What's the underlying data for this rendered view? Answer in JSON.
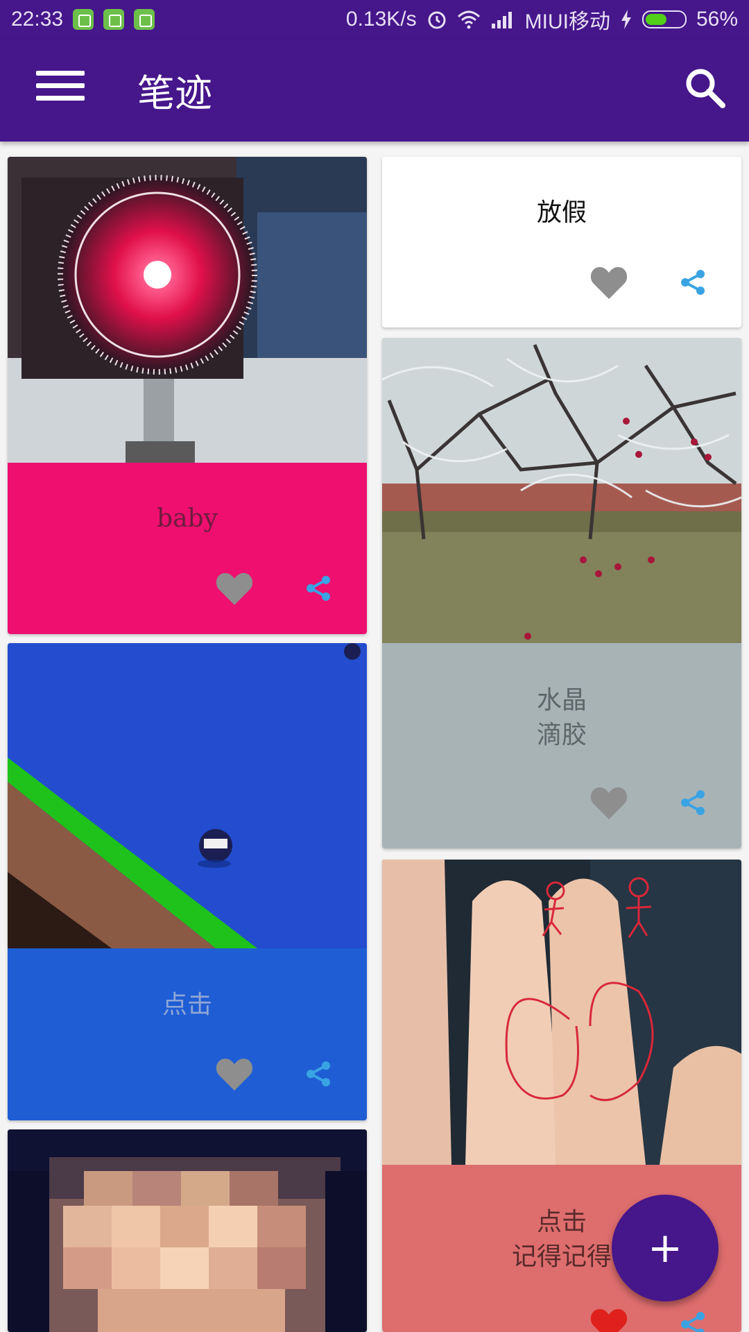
{
  "status_bar": {
    "time": "22:33",
    "speed": "0.13K/s",
    "carrier": "MIUI移动",
    "battery": "56%",
    "battery_level": 0.56
  },
  "app_bar": {
    "title": "笔迹",
    "menu_icon": "hamburger-menu-icon",
    "search_icon": "search-icon"
  },
  "notes": [
    {
      "id": "baby",
      "text": "baby",
      "image": "laser-protractor-photo",
      "color": "#ee0f6f",
      "text_color": "#6d1c3d",
      "liked": false
    },
    {
      "id": "fangjia",
      "text": "放假",
      "image": null,
      "color": "#ffffff",
      "text_color": "#111111",
      "liked": false
    },
    {
      "id": "shuijing",
      "text": "水晶\n滴胶",
      "image": "frosted-tree-photo",
      "color": "#a8b3b6",
      "text_color": "#5d6668",
      "liked": false
    },
    {
      "id": "dianji1",
      "text": "点击",
      "image": "billiard-table-photo",
      "color": "#1f5dd4",
      "text_color": "#8fa6d6",
      "liked": false
    },
    {
      "id": "dianji2",
      "text": "点击\n记得记得",
      "image": "finger-drawing-photo",
      "color": "#de6d6e",
      "text_color": "#5a2a2a",
      "liked": true
    },
    {
      "id": "portrait",
      "text": "",
      "image": "pixelated-portrait-photo",
      "color": "#222222",
      "text_color": "#ffffff",
      "liked": false
    }
  ],
  "colors": {
    "primary": "#46168b",
    "like_inactive": "#8e8e8e",
    "like_active": "#e0201c",
    "share": "#3aa3e3"
  },
  "fab": {
    "label": "+",
    "icon": "add-icon"
  }
}
